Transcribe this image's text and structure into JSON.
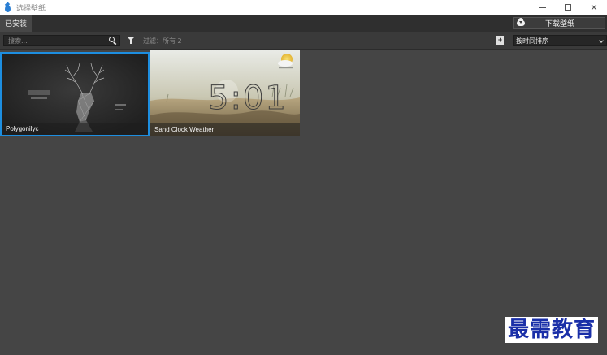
{
  "window": {
    "title": "选择壁纸"
  },
  "tabs": [
    {
      "label": "已安装"
    }
  ],
  "toolbar": {
    "download_label": "下载壁纸",
    "search_placeholder": "搜索...",
    "filter_text": "过滤：所有 2",
    "sort_value": "按时间排序"
  },
  "wallpapers": [
    {
      "title": "Polygonilyc"
    },
    {
      "title": "Sand Clock Weather",
      "clock_text": "5:01"
    }
  ],
  "watermark": {
    "text": "最需教育"
  },
  "colors": {
    "accent": "#1d8ee0",
    "background": "#454545",
    "toolbar": "#3a3a3a"
  }
}
